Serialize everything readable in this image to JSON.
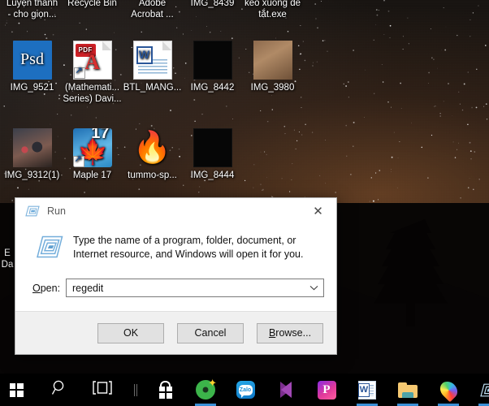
{
  "desktop": {
    "row_top_labels": [
      {
        "name": "desktop-icon-luyen-thanh",
        "line1": "Luyện thanh",
        "line2": "- cho giọn..."
      },
      {
        "name": "desktop-icon-recycle-bin",
        "line1": "Recycle Bin",
        "line2": ""
      },
      {
        "name": "desktop-icon-adobe-acrobat",
        "line1": "Adobe",
        "line2": "Acrobat ..."
      },
      {
        "name": "desktop-icon-img-8439",
        "line1": "IMG_8439",
        "line2": ""
      },
      {
        "name": "desktop-icon-keo-xuong",
        "line1": "kéo xuống để",
        "line2": "tắt.exe"
      }
    ],
    "row2": [
      {
        "name": "desktop-icon-img-9521",
        "label": "IMG_9521",
        "icon": "psd-icon",
        "glyph": "Psd"
      },
      {
        "name": "desktop-icon-mathematical-series",
        "label": "(Mathemati...",
        "label2": "Series) Davi...",
        "icon": "pdf-icon",
        "glyph": "PDF"
      },
      {
        "name": "desktop-icon-btl-mang",
        "label": "BTL_MANG...",
        "icon": "word-document-icon",
        "glyph": "W"
      },
      {
        "name": "desktop-icon-img-8442",
        "label": "IMG_8442",
        "icon": "image-thumbnail-icon",
        "glyph": ""
      },
      {
        "name": "desktop-icon-img-3980",
        "label": "IMG_3980",
        "icon": "image-thumbnail-icon",
        "glyph": ""
      }
    ],
    "row3": [
      {
        "name": "desktop-icon-img-9312",
        "label": "IMG_9312(1)",
        "icon": "image-thumbnail-icon",
        "glyph": ""
      },
      {
        "name": "desktop-icon-maple-17",
        "label": "Maple 17",
        "icon": "maple-icon",
        "glyph": "17"
      },
      {
        "name": "desktop-icon-tummo",
        "label": "tummo-sp...",
        "icon": "flame-icon",
        "glyph": "🔥"
      },
      {
        "name": "desktop-icon-img-8444",
        "label": "IMG_8444",
        "icon": "image-thumbnail-icon",
        "glyph": ""
      }
    ],
    "behind_dialog": {
      "name": "desktop-icon-partially-hidden",
      "line1": "E",
      "line2": "Da"
    }
  },
  "run_dialog": {
    "title": "Run",
    "close_label": "✕",
    "title_icon": "run-window-icon",
    "main_icon": "run-window-icon",
    "description": "Type the name of a program, folder, document, or Internet resource, and Windows will open it for you.",
    "open_label_accel": "O",
    "open_label_rest": "pen:",
    "open_value": "regedit",
    "open_placeholder": "",
    "dropdown_icon": "chevron-down-icon",
    "buttons": [
      {
        "name": "ok-button",
        "label": "OK",
        "accel": "",
        "rest": "OK"
      },
      {
        "name": "cancel-button",
        "label": "Cancel",
        "accel": "",
        "rest": "Cancel"
      },
      {
        "name": "browse-button",
        "label": "Browse...",
        "accel": "B",
        "rest": "rowse..."
      }
    ],
    "colors": {
      "surface": "#ffffff",
      "footer": "#f0f0f0",
      "button": "#e1e1e1",
      "border": "#adadad"
    }
  },
  "taskbar": {
    "accent": "#3a8fd6",
    "background": "#000000",
    "items": [
      {
        "name": "start-button",
        "icon": "windows-logo-icon",
        "label": "Start",
        "running": false
      },
      {
        "name": "search-button",
        "icon": "search-icon",
        "label": "Search",
        "running": false
      },
      {
        "name": "task-view-button",
        "icon": "task-view-icon",
        "label": "Task View",
        "running": false
      },
      {
        "name": "taskbar-separator",
        "icon": "separator-icon",
        "label": "",
        "running": false
      },
      {
        "name": "taskbar-microsoft-store",
        "icon": "store-icon",
        "label": "Microsoft Store",
        "running": false
      },
      {
        "name": "taskbar-disc-app",
        "icon": "green-disc-icon",
        "label": "Disc App",
        "running": true
      },
      {
        "name": "taskbar-zalo",
        "icon": "zalo-icon",
        "label": "Zalo",
        "running": false
      },
      {
        "name": "taskbar-visual-studio",
        "icon": "visual-studio-icon",
        "label": "Visual Studio",
        "running": false
      },
      {
        "name": "taskbar-picsart",
        "icon": "picsart-icon",
        "label": "PicsArt",
        "running": false
      },
      {
        "name": "taskbar-word",
        "icon": "word-icon",
        "label": "Word",
        "running": true
      },
      {
        "name": "taskbar-file-explorer",
        "icon": "folder-icon",
        "label": "File Explorer",
        "running": true
      },
      {
        "name": "taskbar-rainbow-app",
        "icon": "rainbow-drop-icon",
        "label": "Rainbow App",
        "running": true
      },
      {
        "name": "taskbar-run-dialog",
        "icon": "run-window-icon",
        "label": "Run",
        "running": true
      }
    ]
  }
}
